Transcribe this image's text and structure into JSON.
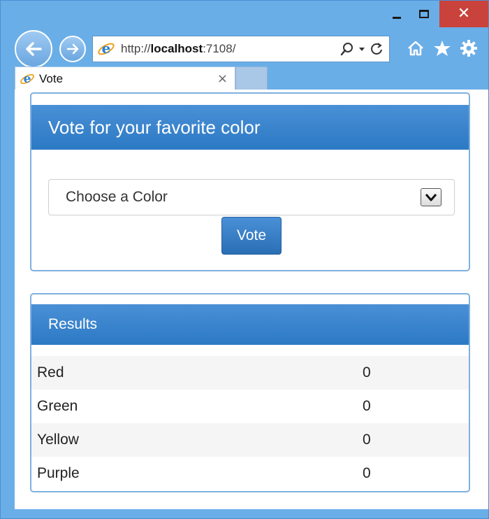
{
  "browser": {
    "address": {
      "scheme": "http://",
      "host": "localhost",
      "port_path": ":7108/"
    },
    "tab": {
      "title": "Vote",
      "close_glyph": "×"
    },
    "window_controls": {
      "close_glyph": "✕"
    },
    "icons": [
      "back-icon",
      "forward-icon",
      "ie-icon",
      "search-icon",
      "dropdown-icon",
      "refresh-icon",
      "home-icon",
      "favorites-icon",
      "settings-icon"
    ]
  },
  "vote_panel": {
    "heading": "Vote for your favorite color",
    "select": {
      "selected": "Choose a Color"
    },
    "button_label": "Vote"
  },
  "results_panel": {
    "heading": "Results",
    "rows": [
      {
        "name": "Red",
        "count": "0"
      },
      {
        "name": "Green",
        "count": "0"
      },
      {
        "name": "Yellow",
        "count": "0"
      },
      {
        "name": "Purple",
        "count": "0"
      }
    ]
  },
  "colors": {
    "accent": "#2c79c4",
    "frame": "#6aaee8",
    "close": "#c9423b"
  }
}
